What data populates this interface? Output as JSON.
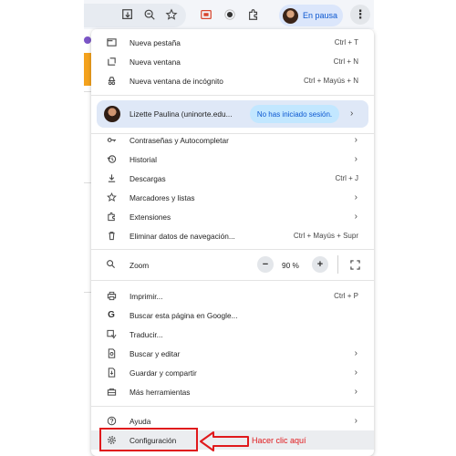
{
  "toolbar": {
    "icons": [
      "install-icon",
      "zoom-icon",
      "bookmark-star-icon",
      "cast-icon",
      "record-icon",
      "extensions-icon"
    ],
    "profile_status": "En pausa",
    "menu_icon": "⋮"
  },
  "menu": {
    "top_items": [
      {
        "label": "Nueva pestaña",
        "shortcut": "Ctrl + T"
      },
      {
        "label": "Nueva ventana",
        "shortcut": "Ctrl + N"
      },
      {
        "label": "Nueva ventana de incógnito",
        "shortcut": "Ctrl + Mayús + N"
      }
    ],
    "profile": {
      "name": "Lizette Paulina (uninorte.edu...",
      "status": "No has iniciado sesión."
    },
    "mid_items": [
      {
        "label": "Contraseñas y Autocompletar",
        "shortcut": ""
      },
      {
        "label": "Historial",
        "shortcut": ""
      },
      {
        "label": "Descargas",
        "shortcut": "Ctrl + J"
      },
      {
        "label": "Marcadores y listas",
        "shortcut": ""
      },
      {
        "label": "Extensiones",
        "shortcut": ""
      },
      {
        "label": "Eliminar datos de navegación...",
        "shortcut": "Ctrl + Mayús + Supr"
      }
    ],
    "zoom": {
      "label": "Zoom",
      "minus": "−",
      "value": "90 %",
      "plus": "+"
    },
    "tool_items": [
      {
        "label": "Imprimir...",
        "shortcut": "Ctrl + P"
      },
      {
        "label": "Buscar esta página en Google...",
        "shortcut": ""
      },
      {
        "label": "Traducir...",
        "shortcut": ""
      },
      {
        "label": "Buscar y editar",
        "shortcut": ""
      },
      {
        "label": "Guardar y compartir",
        "shortcut": ""
      },
      {
        "label": "Más herramientas",
        "shortcut": ""
      }
    ],
    "bottom_items": [
      {
        "label": "Ayuda"
      },
      {
        "label": "Configuración"
      }
    ]
  },
  "annotation": {
    "text": "Hacer clic aquí",
    "color": "#e0191c"
  }
}
